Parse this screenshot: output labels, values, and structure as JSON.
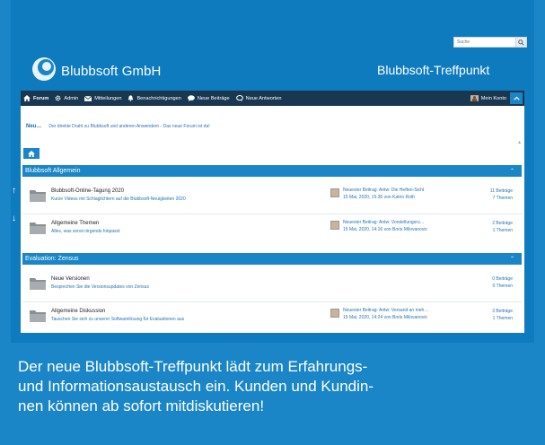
{
  "header": {
    "search_placeholder": "Suche",
    "logo_text": "Blubbsoft GmbH",
    "site_title": "Blubbsoft-Treffpunkt"
  },
  "nav": {
    "items": [
      {
        "label": "Forum",
        "icon": "chat-bubbles-icon"
      },
      {
        "label": "Admin",
        "icon": "gear-icon"
      },
      {
        "label": "Mitteilungen",
        "icon": "envelope-icon"
      },
      {
        "label": "Benachrichtigungen",
        "icon": "bell-icon"
      },
      {
        "label": "Neue Beiträge",
        "icon": "speech-icon"
      },
      {
        "label": "Neue Antworten",
        "icon": "reply-icon"
      }
    ],
    "account_label": "Mein Konto"
  },
  "news": {
    "label": "Neu…",
    "text": "Der direkte Draht zu Blubbsoft und anderen Anwendern - Das neue Forum ist da!"
  },
  "sections": [
    {
      "title": "Blubbsoft Allgemein",
      "forums": [
        {
          "title": "Blubbsoft-Online-Tagung 2020",
          "desc": "Kurze Videos mit Schlaglichtern auf die Blubbsoft-Neuigkeiten 2020",
          "last_title": "Neuester Beitrag: Antw: Die Heften-Sicht",
          "last_meta": "15 Mai, 2020, 15:36 von Katrin Roth",
          "posts": "11 Beiträge",
          "topics": "7 Themen",
          "has_last": true
        },
        {
          "title": "Allgemeine Themen",
          "desc": "Alles, was sonst nirgends hinpasst",
          "last_title": "Neuester Beitrag: Antw: Vorstellungsru…",
          "last_meta": "15 Mai, 2020, 14:16 von Boris Milovanovic",
          "posts": "2 Beiträge",
          "topics": "1 Themen",
          "has_last": true
        }
      ]
    },
    {
      "title": "Evaluation: Zensus",
      "forums": [
        {
          "title": "Neue Versionen",
          "desc": "Besprechen Sie die Versionsupdates von Zensus",
          "last_title": "",
          "last_meta": "",
          "posts": "0 Beiträge",
          "topics": "0 Themen",
          "has_last": false
        },
        {
          "title": "Allgemeine Diskussion",
          "desc": "Tauschen Sie sich zu unserer Softwarelösung für Evaluationen aus",
          "last_title": "Neuester Beitrag: Antw: Versand an meh…",
          "last_meta": "15 Mai, 2020, 14:24 von Boris Milovanovic",
          "posts": "3 Beiträge",
          "topics": "1 Themen",
          "has_last": true
        }
      ]
    }
  ],
  "caption": {
    "line1": "Der neue Blubbsoft-Treffpunkt lädt zum Erfahrungs-",
    "line2": "und Informationsaustausch ein. Kunden und Kundin-",
    "line3": "nen können ab sofort mitdiskutieren!"
  },
  "colors": {
    "background": "#1a86c7",
    "navbar": "#193750",
    "section_header": "#1a86c7",
    "link": "#2a72b5"
  }
}
